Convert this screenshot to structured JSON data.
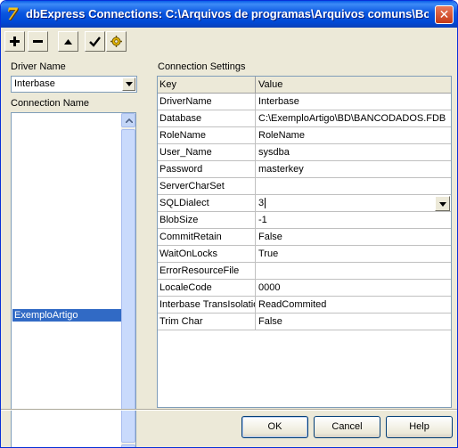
{
  "window": {
    "title": "dbExpress Connections: C:\\Arquivos de programas\\Arquivos comuns\\Bo...",
    "close_glyph": "✕"
  },
  "toolbar": {
    "buttons": [
      {
        "name": "add-button",
        "icon": "plus-icon",
        "glyph": "+"
      },
      {
        "name": "delete-button",
        "icon": "minus-icon",
        "glyph": "−"
      },
      {
        "name": "move-up-button",
        "icon": "triangle-up-icon"
      },
      {
        "name": "apply-button",
        "icon": "checkmark-icon",
        "glyph": "✓"
      },
      {
        "name": "settings-button",
        "icon": "gear-icon"
      }
    ]
  },
  "left": {
    "driver_label": "Driver Name",
    "driver_value": "Interbase",
    "connection_label": "Connection Name",
    "connections": [
      "ExemploArtigo"
    ],
    "selected": "ExemploArtigo"
  },
  "right": {
    "settings_label": "Connection Settings",
    "columns": [
      "Key",
      "Value"
    ],
    "rows": [
      {
        "key": "DriverName",
        "value": "Interbase"
      },
      {
        "key": "Database",
        "value": "C:\\ExemploArtigo\\BD\\BANCODADOS.FDB"
      },
      {
        "key": "RoleName",
        "value": "RoleName"
      },
      {
        "key": "User_Name",
        "value": "sysdba"
      },
      {
        "key": "Password",
        "value": "masterkey"
      },
      {
        "key": "ServerCharSet",
        "value": ""
      },
      {
        "key": "SQLDialect",
        "value": "3"
      },
      {
        "key": "BlobSize",
        "value": "-1"
      },
      {
        "key": "CommitRetain",
        "value": "False"
      },
      {
        "key": "WaitOnLocks",
        "value": "True"
      },
      {
        "key": "ErrorResourceFile",
        "value": ""
      },
      {
        "key": "LocaleCode",
        "value": "0000"
      },
      {
        "key": "Interbase TransIsolatio",
        "value": "ReadCommited"
      },
      {
        "key": "Trim Char",
        "value": "False"
      }
    ]
  },
  "buttons": {
    "ok": "OK",
    "cancel": "Cancel",
    "help": "Help"
  },
  "colors": {
    "selection": "#316ac5",
    "titlebar": "#0a56e0"
  }
}
